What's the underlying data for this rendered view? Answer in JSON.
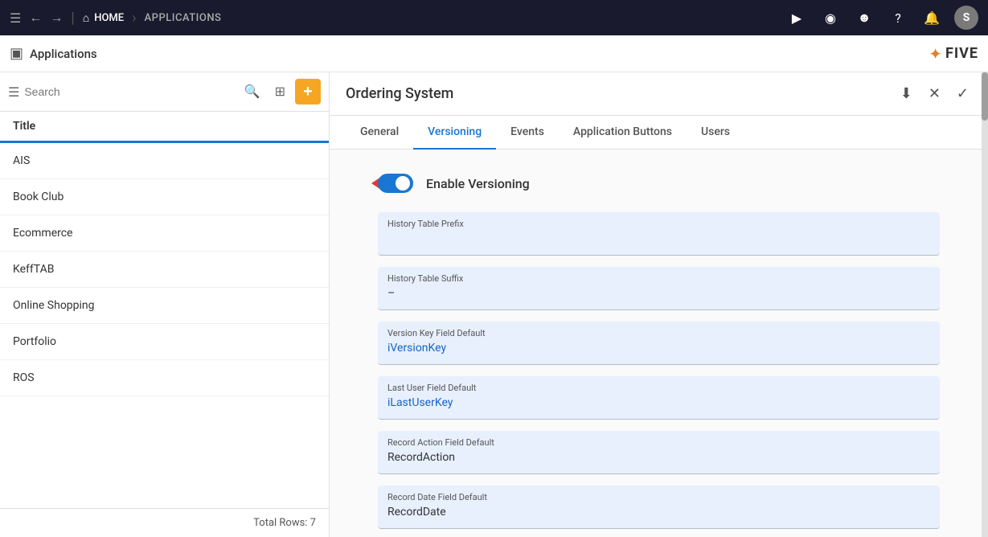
{
  "topNav": {
    "homeLabel": "HOME",
    "applicationsLabel": "APPLICATIONS",
    "rightIcons": [
      "play-icon",
      "broadcast-icon",
      "robot-icon",
      "help-icon",
      "bell-icon"
    ],
    "avatarLabel": "S"
  },
  "secondBar": {
    "sidebarToggleSymbol": "☰",
    "appLabel": "Applications",
    "logoStar": "✦",
    "logoText": "FIVE"
  },
  "sidebar": {
    "searchPlaceholder": "Search",
    "headerTitle": "Title",
    "items": [
      {
        "label": "AIS"
      },
      {
        "label": "Book Club"
      },
      {
        "label": "Ecommerce"
      },
      {
        "label": "KeffTAB"
      },
      {
        "label": "Online Shopping"
      },
      {
        "label": "Portfolio"
      },
      {
        "label": "ROS"
      }
    ],
    "footerText": "Total Rows: 7"
  },
  "content": {
    "title": "Ordering System",
    "downloadIconLabel": "⬇",
    "closeIconLabel": "✕",
    "checkIconLabel": "✓",
    "tabs": [
      {
        "label": "General",
        "active": false
      },
      {
        "label": "Versioning",
        "active": true
      },
      {
        "label": "Events",
        "active": false
      },
      {
        "label": "Application Buttons",
        "active": false
      },
      {
        "label": "Users",
        "active": false
      }
    ],
    "form": {
      "enableVersioningLabel": "Enable Versioning",
      "fields": [
        {
          "label": "History Table Prefix",
          "value": ""
        },
        {
          "label": "History Table Suffix",
          "value": "–"
        },
        {
          "label": "Version Key Field Default",
          "value": "iVersionKey",
          "valueClass": "blue"
        },
        {
          "label": "Last User Field Default",
          "value": "iLastUserKey",
          "valueClass": "blue"
        },
        {
          "label": "Record Action Field Default",
          "value": "RecordAction",
          "valueClass": ""
        },
        {
          "label": "Record Date Field Default",
          "value": "RecordDate",
          "valueClass": ""
        }
      ]
    }
  }
}
